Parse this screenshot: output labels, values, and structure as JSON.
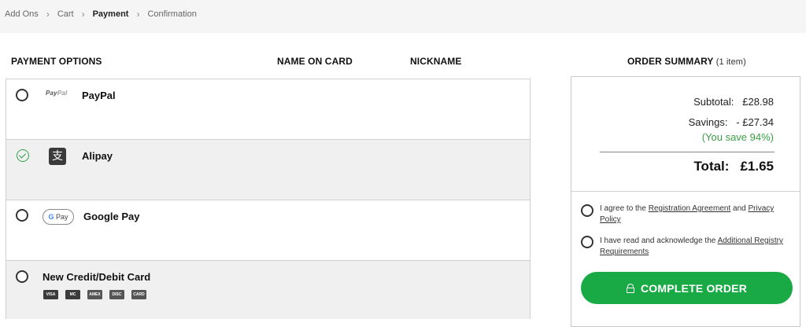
{
  "breadcrumb": {
    "steps": [
      "Add Ons",
      "Cart",
      "Payment",
      "Confirmation"
    ],
    "active": "Payment"
  },
  "headers": {
    "payment_options": "PAYMENT OPTIONS",
    "name_on_card": "NAME ON CARD",
    "nickname": "NICKNAME",
    "order_summary": "ORDER SUMMARY",
    "item_count": "(1 item)"
  },
  "payment_options": [
    {
      "label": "PayPal",
      "logo_text_a": "Pay",
      "logo_text_b": "Pal",
      "selected": false
    },
    {
      "label": "Alipay",
      "icon": "alipay-icon",
      "icon_glyph": "支",
      "selected": true
    },
    {
      "label": "Google Pay",
      "logo_g": "G",
      "logo_text": "Pay",
      "selected": false
    },
    {
      "label": "New Credit/Debit Card",
      "selected": false,
      "cards": [
        "VISA",
        "MC",
        "AMEX",
        "DISC",
        "CARD"
      ]
    }
  ],
  "summary": {
    "subtotal_label": "Subtotal:",
    "subtotal_value": "£28.98",
    "savings_label": "Savings:",
    "savings_value": "- £27.34",
    "savings_note": "(You save 94%)",
    "total_label": "Total:",
    "total_value": "£1.65"
  },
  "agreements": {
    "a1_prefix": "I agree to the ",
    "a1_link1": "Registration Agreement",
    "a1_mid": " and ",
    "a1_link2": "Privacy Policy",
    "a2_prefix": "I have read and acknowledge the ",
    "a2_link": "Additional Registry Requirements"
  },
  "button": {
    "label": "COMPLETE ORDER"
  },
  "colors": {
    "accent": "#1aaa45",
    "savings": "#3aa046",
    "check": "#2fa24a"
  }
}
